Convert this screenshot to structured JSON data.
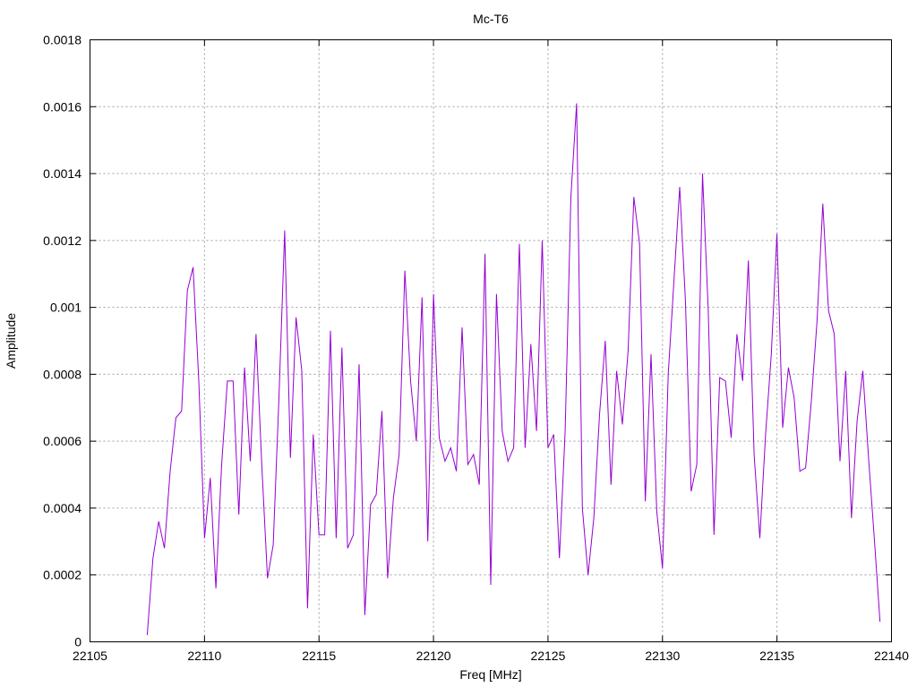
{
  "chart_data": {
    "type": "line",
    "title": "Mc-T6",
    "xlabel": "Freq [MHz]",
    "ylabel": "Amplitude",
    "xlim": [
      22105,
      22140
    ],
    "ylim": [
      0,
      0.0018
    ],
    "grid": true,
    "x_ticks": [
      "22105",
      "22110",
      "22115",
      "22120",
      "22125",
      "22130",
      "22135",
      "22140"
    ],
    "y_ticks": [
      "0",
      "0.0002",
      "0.0004",
      "0.0006",
      "0.0008",
      "0.001",
      "0.0012",
      "0.0014",
      "0.0016",
      "0.0018"
    ],
    "series": [
      {
        "color": "#9400d3",
        "x": [
          22107.5,
          22107.75,
          22108.0,
          22108.25,
          22108.5,
          22108.75,
          22109.0,
          22109.25,
          22109.5,
          22109.75,
          22110.0,
          22110.25,
          22110.5,
          22110.75,
          22111.0,
          22111.25,
          22111.5,
          22111.75,
          22112.0,
          22112.25,
          22112.5,
          22112.75,
          22113.0,
          22113.25,
          22113.5,
          22113.75,
          22114.0,
          22114.25,
          22114.5,
          22114.75,
          22115.0,
          22115.25,
          22115.5,
          22115.75,
          22116.0,
          22116.25,
          22116.5,
          22116.75,
          22117.0,
          22117.25,
          22117.5,
          22117.75,
          22118.0,
          22118.25,
          22118.5,
          22118.75,
          22119.0,
          22119.25,
          22119.5,
          22119.75,
          22120.0,
          22120.25,
          22120.5,
          22120.75,
          22121.0,
          22121.25,
          22121.5,
          22121.75,
          22122.0,
          22122.25,
          22122.5,
          22122.75,
          22123.0,
          22123.25,
          22123.5,
          22123.75,
          22124.0,
          22124.25,
          22124.5,
          22124.75,
          22125.0,
          22125.25,
          22125.5,
          22125.75,
          22126.0,
          22126.25,
          22126.5,
          22126.75,
          22127.0,
          22127.25,
          22127.5,
          22127.75,
          22128.0,
          22128.25,
          22128.5,
          22128.75,
          22129.0,
          22129.25,
          22129.5,
          22129.75,
          22130.0,
          22130.25,
          22130.5,
          22130.75,
          22131.0,
          22131.25,
          22131.5,
          22131.75,
          22132.0,
          22132.25,
          22132.5,
          22132.75,
          22133.0,
          22133.25,
          22133.5,
          22133.75,
          22134.0,
          22134.25,
          22134.5,
          22134.75,
          22135.0,
          22135.25,
          22135.5,
          22135.75,
          22136.0,
          22136.25,
          22136.5,
          22136.75,
          22137.0,
          22137.25,
          22137.5,
          22137.75,
          22138.0,
          22138.25,
          22138.5,
          22138.75,
          22139.0,
          22139.25,
          22139.5
        ],
        "values": [
          2e-05,
          0.00025,
          0.00036,
          0.00028,
          0.00051,
          0.00067,
          0.00069,
          0.00105,
          0.00112,
          0.00078,
          0.00031,
          0.00049,
          0.00016,
          0.00053,
          0.00078,
          0.00078,
          0.00038,
          0.00082,
          0.00054,
          0.00092,
          0.00053,
          0.00019,
          0.00029,
          0.00073,
          0.00123,
          0.00055,
          0.00097,
          0.00081,
          0.0001,
          0.00062,
          0.00032,
          0.00032,
          0.00093,
          0.00031,
          0.00088,
          0.00028,
          0.00032,
          0.00083,
          8e-05,
          0.00041,
          0.00044,
          0.00069,
          0.00019,
          0.00043,
          0.00056,
          0.00111,
          0.00078,
          0.0006,
          0.00103,
          0.0003,
          0.00104,
          0.00061,
          0.00054,
          0.00058,
          0.00051,
          0.00094,
          0.00053,
          0.00056,
          0.00047,
          0.00116,
          0.00017,
          0.00104,
          0.00063,
          0.00054,
          0.00058,
          0.00119,
          0.00058,
          0.00089,
          0.00063,
          0.0012,
          0.00058,
          0.00062,
          0.00025,
          0.00063,
          0.00133,
          0.00161,
          0.0004,
          0.0002,
          0.00037,
          0.00068,
          0.0009,
          0.00047,
          0.00081,
          0.00065,
          0.00087,
          0.00133,
          0.00119,
          0.00042,
          0.00086,
          0.00039,
          0.00022,
          0.0008,
          0.00108,
          0.00136,
          0.00102,
          0.00045,
          0.00053,
          0.0014,
          0.00099,
          0.00032,
          0.00079,
          0.00078,
          0.00061,
          0.00092,
          0.00078,
          0.00114,
          0.00056,
          0.00031,
          0.00062,
          0.00086,
          0.00122,
          0.00064,
          0.00082,
          0.00073,
          0.00051,
          0.00052,
          0.00072,
          0.00096,
          0.00131,
          0.00099,
          0.00092,
          0.00054,
          0.00081,
          0.00037,
          0.00066,
          0.00081,
          0.00055,
          0.00031,
          6e-05
        ]
      }
    ]
  }
}
